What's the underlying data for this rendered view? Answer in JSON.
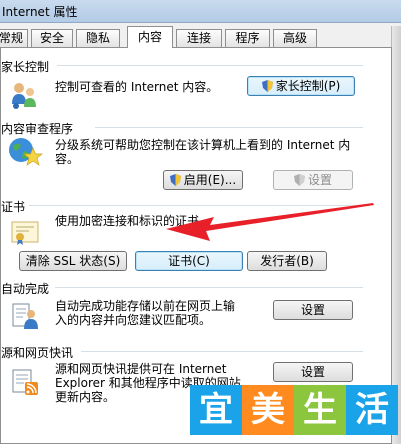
{
  "window": {
    "title": "Internet 属性"
  },
  "tabs": [
    {
      "label": "常规"
    },
    {
      "label": "安全"
    },
    {
      "label": "隐私"
    },
    {
      "label": "内容"
    },
    {
      "label": "连接"
    },
    {
      "label": "程序"
    },
    {
      "label": "高级"
    }
  ],
  "active_tab": "内容",
  "sections": {
    "parental": {
      "title": "家长控制",
      "description": "控制可查看的 Internet 内容。",
      "button": "家长控制(P)"
    },
    "advisor": {
      "title": "内容审查程序",
      "description_line1": "分级系统可帮助您控制在该计算机上看到的 Internet 内",
      "description_line2": "容。",
      "enable_button": "启用(E)...",
      "settings_button": "设置"
    },
    "certificates": {
      "title": "证书",
      "description": "使用加密连接和标识的证书。",
      "clear_ssl_button": "清除 SSL 状态(S)",
      "certificates_button": "证书(C)",
      "publishers_button": "发行者(B)"
    },
    "autocomplete": {
      "title": "自动完成",
      "description_line1": "自动完成功能存储以前在网页上输",
      "description_line2": "入的内容并向您建议匹配项。",
      "settings_button": "设置"
    },
    "feeds": {
      "title": "源和网页快讯",
      "description_line1": "源和网页快讯提供可在 Internet",
      "description_line2": "Explorer 和其他程序中读取的网站",
      "description_line3": "更新内容。",
      "settings_button": "设置"
    }
  },
  "watermark": {
    "chars": [
      "宜",
      "美",
      "生",
      "活"
    ],
    "colors": [
      "#1aa3e8",
      "#ff8a1f",
      "#8cc63e",
      "#1aa3e8"
    ]
  },
  "colors": {
    "arrow": "#e8202a"
  }
}
